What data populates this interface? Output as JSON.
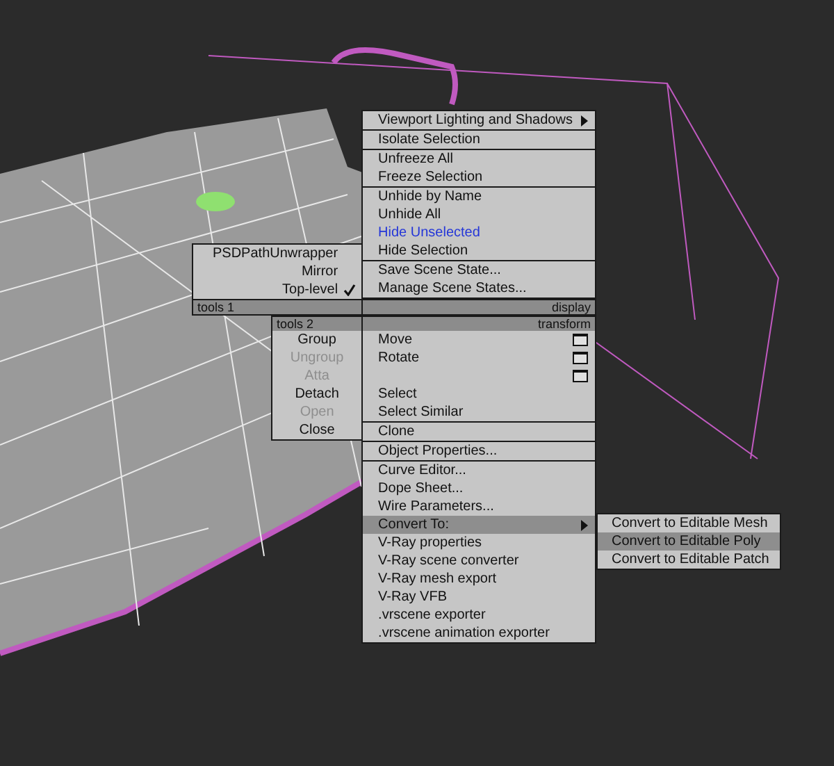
{
  "tools1_quad": {
    "header": "tools 1",
    "items": [
      {
        "label": "PSDPathUnwrapper",
        "checked": false
      },
      {
        "label": "Mirror",
        "checked": false
      },
      {
        "label": "Top-level",
        "checked": true
      }
    ]
  },
  "display_quad": {
    "header": "display",
    "sections": [
      [
        {
          "label": "Viewport Lighting and Shadows",
          "kind": "submenu"
        }
      ],
      [
        {
          "label": "Isolate Selection",
          "kind": "normal"
        }
      ],
      [
        {
          "label": "Unfreeze All",
          "kind": "normal"
        },
        {
          "label": "Freeze Selection",
          "kind": "normal"
        }
      ],
      [
        {
          "label": "Unhide by Name",
          "kind": "normal"
        },
        {
          "label": "Unhide All",
          "kind": "normal"
        },
        {
          "label": "Hide Unselected",
          "kind": "recent"
        },
        {
          "label": "Hide Selection",
          "kind": "normal"
        }
      ],
      [
        {
          "label": "Save Scene State...",
          "kind": "normal"
        },
        {
          "label": "Manage Scene States...",
          "kind": "normal"
        }
      ]
    ]
  },
  "tools2_quad": {
    "header": "tools 2",
    "items": [
      {
        "label": "Group",
        "disabled": false
      },
      {
        "label": "Ungroup",
        "disabled": true
      },
      {
        "label": "Atta",
        "disabled": true
      },
      {
        "label": "Detach",
        "disabled": false
      },
      {
        "label": "Open",
        "disabled": true
      },
      {
        "label": "Close",
        "disabled": false
      }
    ]
  },
  "transform_quad": {
    "header": "transform",
    "sections": [
      [
        {
          "label": "Move",
          "kind": "dialog",
          "highlighted": false
        },
        {
          "label": "Rotate",
          "kind": "dialog",
          "highlighted": false
        },
        {
          "kind": "dialog",
          "highlighted": false
        },
        {
          "label": "Select",
          "kind": "normal",
          "highlighted": false
        },
        {
          "label": "Select Similar",
          "kind": "normal",
          "highlighted": false
        }
      ],
      [
        {
          "label": "Clone",
          "kind": "normal",
          "highlighted": false
        }
      ],
      [
        {
          "label": "Object Properties...",
          "kind": "normal",
          "highlighted": false
        }
      ],
      [
        {
          "label": "Curve Editor...",
          "kind": "normal",
          "highlighted": false
        },
        {
          "label": "Dope Sheet...",
          "kind": "normal",
          "highlighted": false
        },
        {
          "label": "Wire Parameters...",
          "kind": "normal",
          "highlighted": false
        },
        {
          "label": "Convert To:",
          "kind": "submenu",
          "highlighted": true,
          "submenu": [
            {
              "label": "Convert to Editable Mesh",
              "highlighted": false
            },
            {
              "label": "Convert to Editable Poly",
              "highlighted": true
            },
            {
              "label": "Convert to Editable Patch",
              "highlighted": false
            }
          ]
        },
        {
          "label": "V-Ray properties",
          "kind": "normal",
          "highlighted": false
        },
        {
          "label": "V-Ray scene converter",
          "kind": "normal",
          "highlighted": false
        },
        {
          "label": "V-Ray mesh export",
          "kind": "normal",
          "highlighted": false
        },
        {
          "label": "V-Ray VFB",
          "kind": "normal",
          "highlighted": false
        },
        {
          "label": ".vrscene exporter",
          "kind": "normal",
          "highlighted": false
        },
        {
          "label": ".vrscene animation exporter",
          "kind": "normal",
          "highlighted": false
        }
      ]
    ]
  }
}
